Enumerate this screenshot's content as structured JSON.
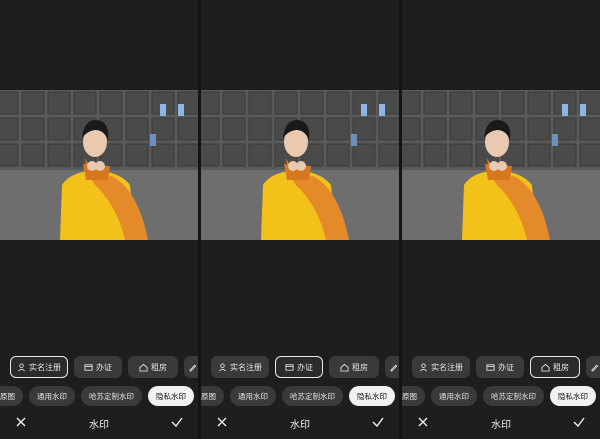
{
  "panels": [
    {
      "row1": [
        {
          "label": "实名注册",
          "icon": "person-icon",
          "selected": true
        },
        {
          "label": "办证",
          "icon": "card-icon",
          "selected": false
        },
        {
          "label": "租房",
          "icon": "house-icon",
          "selected": false
        },
        {
          "label": "",
          "icon": "pen-icon",
          "selected": false
        }
      ],
      "row2": [
        {
          "label": "原图",
          "selected": false
        },
        {
          "label": "通用水印",
          "selected": false
        },
        {
          "label": "哈苏定制水印",
          "selected": false
        },
        {
          "label": "隐私水印",
          "selected": true
        }
      ],
      "title": "水印"
    },
    {
      "row1": [
        {
          "label": "实名注册",
          "icon": "person-icon",
          "selected": false
        },
        {
          "label": "办证",
          "icon": "card-icon",
          "selected": true
        },
        {
          "label": "租房",
          "icon": "house-icon",
          "selected": false
        },
        {
          "label": "",
          "icon": "pen-icon",
          "selected": false
        }
      ],
      "row2": [
        {
          "label": "原图",
          "selected": false
        },
        {
          "label": "通用水印",
          "selected": false
        },
        {
          "label": "哈苏定制水印",
          "selected": false
        },
        {
          "label": "隐私水印",
          "selected": true
        }
      ],
      "title": "水印"
    },
    {
      "row1": [
        {
          "label": "实名注册",
          "icon": "person-icon",
          "selected": false
        },
        {
          "label": "办证",
          "icon": "card-icon",
          "selected": false
        },
        {
          "label": "租房",
          "icon": "house-icon",
          "selected": true
        },
        {
          "label": "",
          "icon": "pen-icon",
          "selected": false
        }
      ],
      "row2": [
        {
          "label": "原图",
          "selected": false
        },
        {
          "label": "通用水印",
          "selected": false
        },
        {
          "label": "哈苏定制水印",
          "selected": false
        },
        {
          "label": "隐私水印",
          "selected": true
        }
      ],
      "title": "水印"
    }
  ],
  "colors": {
    "background": "#1e1e1e",
    "chip": "#3a3a3a",
    "selected_pill": "#f2f2f2",
    "coat": "#f2c21a",
    "scarf": "#e58a2a"
  }
}
